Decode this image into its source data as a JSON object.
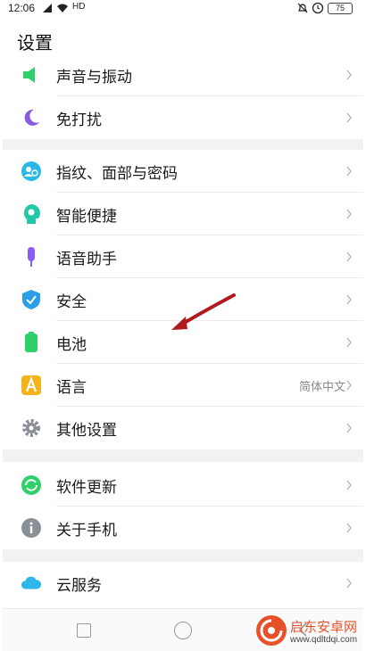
{
  "status_bar": {
    "time": "12:06",
    "network": "HD",
    "battery": "75"
  },
  "page": {
    "title": "设置"
  },
  "sections": [
    {
      "items": [
        {
          "label": "声音与振动",
          "icon": "speaker-icon",
          "color": "#2fcf6a"
        },
        {
          "label": "免打扰",
          "icon": "moon-icon",
          "color": "#8a5be0"
        }
      ]
    },
    {
      "items": [
        {
          "label": "指纹、面部与密码",
          "icon": "face-fingerprint-icon",
          "color": "#2bb7e8"
        },
        {
          "label": "智能便捷",
          "icon": "smart-head-icon",
          "color": "#23c8a8"
        },
        {
          "label": "语音助手",
          "icon": "microphone-icon",
          "color": "#8b5cf6"
        },
        {
          "label": "安全",
          "icon": "shield-icon",
          "color": "#2b9ee8"
        },
        {
          "label": "电池",
          "icon": "battery-icon",
          "color": "#2fcf6a"
        },
        {
          "label": "语言",
          "value": "简体中文",
          "icon": "language-a-icon",
          "color": "#f5b21b"
        },
        {
          "label": "其他设置",
          "icon": "gear-icon",
          "color": "#8a8f98"
        }
      ]
    },
    {
      "items": [
        {
          "label": "软件更新",
          "icon": "update-icon",
          "color": "#2fcf6a"
        },
        {
          "label": "关于手机",
          "icon": "info-icon",
          "color": "#8a8f98"
        }
      ]
    },
    {
      "items": [
        {
          "label": "云服务",
          "icon": "cloud-icon",
          "color": "#2bb7e8"
        }
      ]
    }
  ],
  "watermark": {
    "title": "启东安卓网",
    "url": "www.qdltdqi.com"
  }
}
